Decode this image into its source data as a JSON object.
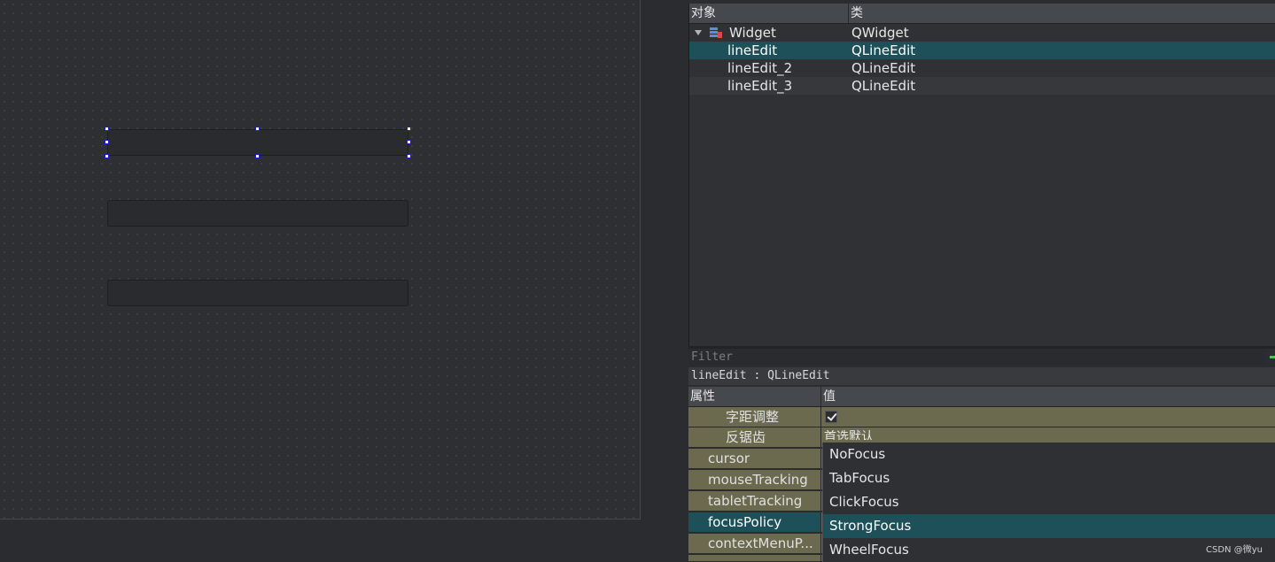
{
  "object_inspector": {
    "columns": {
      "object": "对象",
      "class": "类"
    },
    "rows": [
      {
        "name": "Widget",
        "class": "QWidget"
      },
      {
        "name": "lineEdit",
        "class": "QLineEdit"
      },
      {
        "name": "lineEdit_2",
        "class": "QLineEdit"
      },
      {
        "name": "lineEdit_3",
        "class": "QLineEdit"
      }
    ]
  },
  "property_editor": {
    "filter_placeholder": "Filter",
    "object_label": "lineEdit : QLineEdit",
    "columns": {
      "property": "属性",
      "value": "值"
    },
    "rows": [
      {
        "name": "字距调整",
        "value": ""
      },
      {
        "name": "反锯齿",
        "value": "首选默认"
      },
      {
        "name": "cursor",
        "value": ""
      },
      {
        "name": "mouseTracking",
        "value": ""
      },
      {
        "name": "tabletTracking",
        "value": ""
      },
      {
        "name": "focusPolicy",
        "value": "StrongFocus"
      },
      {
        "name": "contextMenuP...",
        "value": ""
      }
    ]
  },
  "focus_dropdown": {
    "options": [
      "NoFocus",
      "TabFocus",
      "ClickFocus",
      "StrongFocus",
      "WheelFocus"
    ],
    "selected": "StrongFocus"
  },
  "watermark": "CSDN @微yu",
  "colors": {
    "selection": "#1d5058",
    "olive_group": "#6b6a4f",
    "handle_border": "#2020c0"
  }
}
